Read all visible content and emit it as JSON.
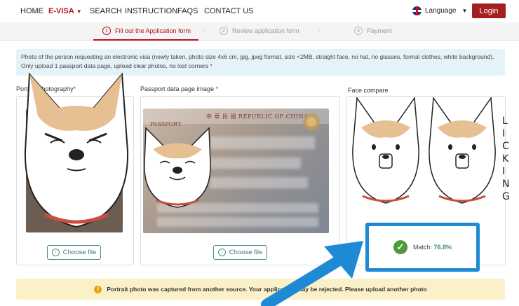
{
  "nav": {
    "home": "HOME",
    "evisa": "E-VISA",
    "search": "SEARCH",
    "instruction": "INSTRUCTION",
    "faqs": "FAQS",
    "contact": "CONTACT US",
    "language": "Language",
    "login": "Login"
  },
  "steps": [
    {
      "num": "1",
      "label": "Fill out the Application form"
    },
    {
      "num": "2",
      "label": "Review application form"
    },
    {
      "num": "3",
      "label": "Payment"
    }
  ],
  "info": {
    "line1": "Photo of the person requesting an electronic visa (newly taken, photo size 4x6 cm, jpg, jpeg format, size <2MB, straight face, no hat, no glasses, formal clothes, white background).",
    "line2": "Only upload 1 passport data page, upload clear photos, no lost corners",
    "req": "*"
  },
  "columns": {
    "portrait_label": "Portrait photography",
    "passport_label": "Passport data page image",
    "face_label": "Face compare",
    "req": "*",
    "choose_file": "Choose file"
  },
  "passport": {
    "header": "中 華 民 國   REPUBLIC OF CHINA",
    "type": "PASSPORT"
  },
  "match": {
    "label": "Match:",
    "value": "76.8%"
  },
  "warning": {
    "text": "Portrait photo was captured from another source. Your application may be rejected. Please upload another photo"
  },
  "overlay": {
    "licking": [
      "L",
      "I",
      "C",
      "K",
      "I",
      "N",
      "G"
    ]
  },
  "colors": {
    "brand": "#a51e22",
    "info_bg": "#e4f3f8",
    "warn_bg": "#fbf1c8",
    "highlight": "#1e8ad6"
  }
}
